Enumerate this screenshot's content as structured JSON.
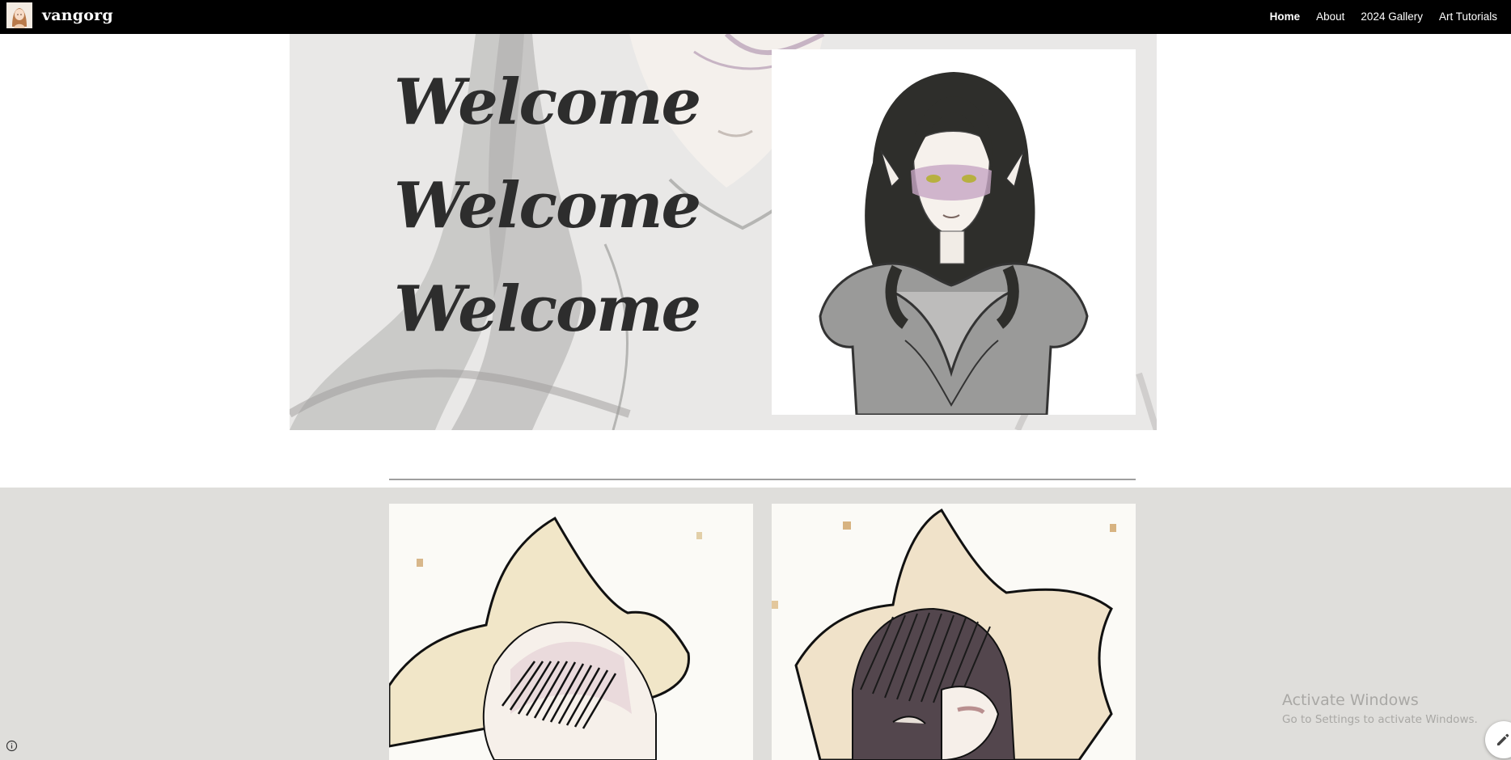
{
  "site": {
    "title": "vangorg"
  },
  "nav": {
    "items": [
      {
        "label": "Home",
        "active": true
      },
      {
        "label": "About",
        "active": false
      },
      {
        "label": "2024 Gallery",
        "active": false
      },
      {
        "label": "Art Tutorials",
        "active": false
      }
    ]
  },
  "hero": {
    "headings": [
      "Welcome",
      "Welcome",
      "Welcome"
    ]
  },
  "windows_watermark": {
    "title": "Activate Windows",
    "subtitle": "Go to Settings to activate Windows."
  },
  "colors": {
    "topbar": "#000000",
    "hero_background": "#e3e2e0",
    "gallery_band": "#dfdedb",
    "heading_text": "#2d2d2d"
  },
  "icons": {
    "info": "info-icon",
    "edit": "pencil-icon"
  }
}
